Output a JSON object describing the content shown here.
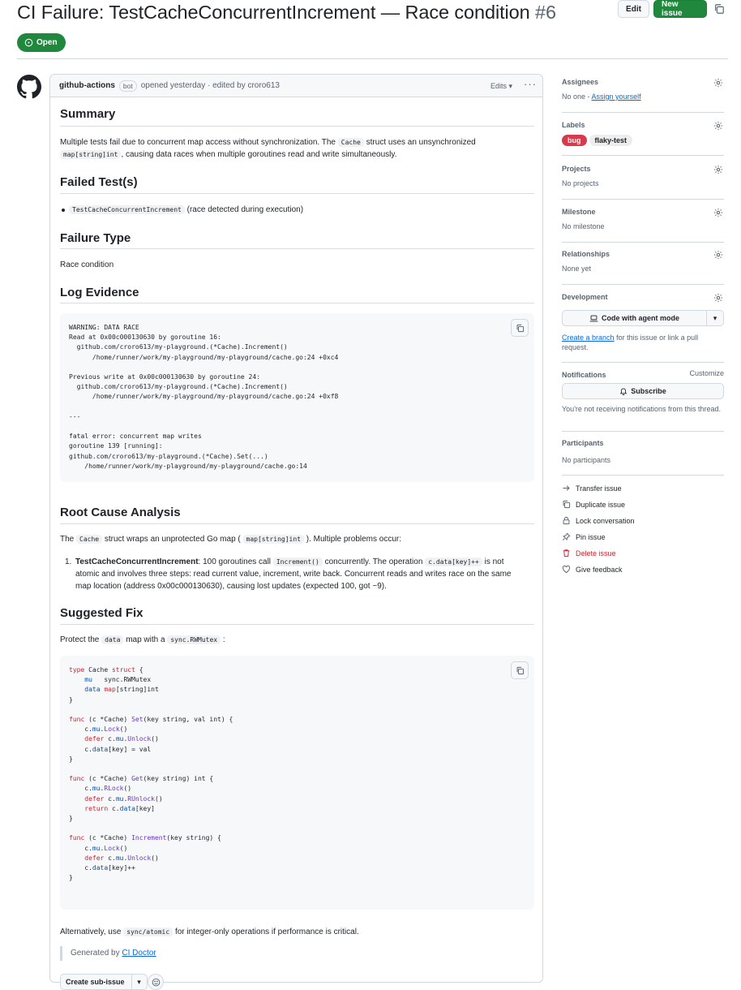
{
  "header": {
    "title": "CI Failure: TestCacheConcurrentIncrement — Race condition",
    "number": "#6",
    "edit_label": "Edit",
    "new_issue_label": "New issue",
    "state": "Open"
  },
  "comment": {
    "author": "github-actions",
    "badge": "bot",
    "meta": "opened yesterday · edited by croro613",
    "edits_label": "Edits",
    "summary_heading": "Summary",
    "summary_text_1": "Multiple tests fail due to concurrent map access without synchronization. The",
    "summary_code_1": "Cache",
    "summary_text_2": "struct uses an unsynchronized",
    "summary_code_2": "map[string]int",
    "summary_text_3": ", causing data races when multiple goroutines read and write simultaneously.",
    "failed_heading": "Failed Test(s)",
    "failed_code": "TestCacheConcurrentIncrement",
    "failed_text": "(race detected during execution)",
    "failure_type_heading": "Failure Type",
    "failure_type": "Race condition",
    "log_heading": "Log Evidence",
    "log_lines": [
      "WARNING: DATA RACE",
      "Read at 0x00c000130630 by goroutine 16:",
      "  github.com/croro613/my-playground.(*Cache).Increment()",
      "      /home/runner/work/my-playground/my-playground/cache.go:24 +0xc4",
      "",
      "Previous write at 0x00c000130630 by goroutine 24:",
      "  github.com/croro613/my-playground.(*Cache).Increment()",
      "      /home/runner/work/my-playground/my-playground/cache.go:24 +0xf8",
      "",
      "---",
      "",
      "fatal error: concurrent map writes",
      "goroutine 139 [running]:",
      "github.com/croro613/my-playground.(*Cache).Set(...)",
      "    /home/runner/work/my-playground/my-playground/cache.go:14"
    ],
    "root_heading": "Root Cause Analysis",
    "root_text_1": "The",
    "root_code_1": "Cache",
    "root_text_2": "struct wraps an unprotected Go map (",
    "root_code_2": "map[string]int",
    "root_text_3": "). Multiple problems occur:",
    "root_item_marker": "1.",
    "root_item_bold": "TestCacheConcurrentIncrement",
    "root_item_text_1": ": 100 goroutines call",
    "root_item_code_1": "Increment()",
    "root_item_text_2": "concurrently. The operation",
    "root_item_code_2": "c.data[key]++",
    "root_item_text_3": "is not",
    "root_item_line_2": "atomic and involves three steps: read current value, increment, write back. Concurrent reads and writes race on the same",
    "root_item_line_3": "map location (address 0x00c000130630), causing lost updates (expected 100, got ~9).",
    "fix_heading": "Suggested Fix",
    "fix_text_1": "Protect the",
    "fix_code_1": "data",
    "fix_text_2": "map with a",
    "fix_code_2": "sync.RWMutex",
    "fix_text_3": ":",
    "alt_text_1": "Alternatively, use",
    "alt_code": "sync/atomic",
    "alt_text_2": "for integer-only operations if performance is critical.",
    "generated_by": "Generated by",
    "generated_link": "CI Doctor",
    "create_sub_issue": "Create sub-issue"
  },
  "sidebar": {
    "assignees_title": "Assignees",
    "assignees_value": "No one -",
    "assign_yourself": "Assign yourself",
    "labels_title": "Labels",
    "labels": [
      "bug",
      "flaky-test"
    ],
    "projects_title": "Projects",
    "projects_value": "No projects",
    "milestone_title": "Milestone",
    "milestone_value": "No milestone",
    "relationships_title": "Relationships",
    "relationships_value": "None yet",
    "development_title": "Development",
    "agent_button": "Code with agent mode",
    "create_branch": "Create a branch",
    "branch_text": "for this issue or link a pull request.",
    "notifications_title": "Notifications",
    "customize": "Customize",
    "subscribe": "Subscribe",
    "notif_text": "You're not receiving notifications from this thread.",
    "participants_title": "Participants",
    "participants_value": "No participants",
    "actions": {
      "transfer": "Transfer issue",
      "duplicate": "Duplicate issue",
      "lock": "Lock conversation",
      "pin": "Pin issue",
      "delete": "Delete issue",
      "feedback": "Give feedback"
    }
  },
  "colors": {
    "accent": "#0969da",
    "open_green": "#1f883d",
    "bug_label": "#d73a4a",
    "danger": "#d1242f"
  }
}
